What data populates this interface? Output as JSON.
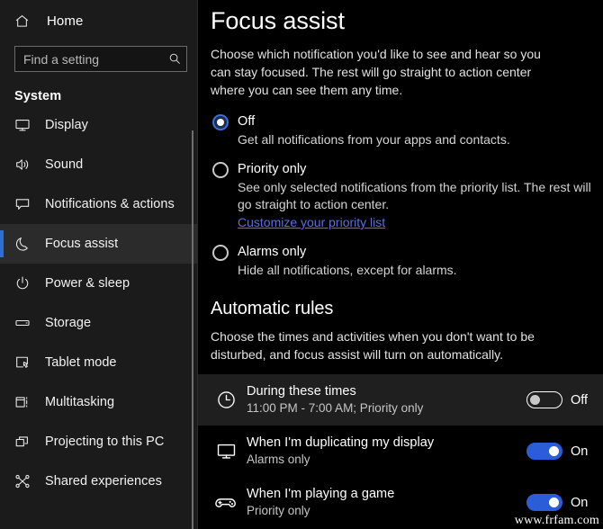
{
  "sidebar": {
    "home": {
      "label": "Home",
      "icon": "home-icon"
    },
    "search": {
      "placeholder": "Find a setting",
      "icon": "search-icon",
      "value": ""
    },
    "group_title": "System",
    "selected_index": 3,
    "accent_color": "#2f6fd0",
    "items": [
      {
        "label": "Display",
        "icon": "monitor-icon"
      },
      {
        "label": "Sound",
        "icon": "speaker-icon"
      },
      {
        "label": "Notifications & actions",
        "icon": "chat-bubble-icon"
      },
      {
        "label": "Focus assist",
        "icon": "moon-icon"
      },
      {
        "label": "Power & sleep",
        "icon": "power-icon"
      },
      {
        "label": "Storage",
        "icon": "drive-icon"
      },
      {
        "label": "Tablet mode",
        "icon": "tablet-icon"
      },
      {
        "label": "Multitasking",
        "icon": "multitask-icon"
      },
      {
        "label": "Projecting to this PC",
        "icon": "project-icon"
      },
      {
        "label": "Shared experiences",
        "icon": "share-icon"
      }
    ]
  },
  "main": {
    "title": "Focus assist",
    "description": "Choose which notification you'd like to see and hear so you can stay focused. The rest will go straight to action center where you can see them any time.",
    "modes": [
      {
        "label": "Off",
        "description": "Get all notifications from your apps and contacts.",
        "selected": true,
        "link": ""
      },
      {
        "label": "Priority only",
        "description": "See only selected notifications from the priority list. The rest will go straight to action center.",
        "selected": false,
        "link": "Customize your priority list"
      },
      {
        "label": "Alarms only",
        "description": "Hide all notifications, except for alarms.",
        "selected": false,
        "link": ""
      }
    ],
    "rules": {
      "title": "Automatic rules",
      "description": "Choose the times and activities when you don't want to be disturbed, and focus assist will turn on automatically.",
      "items": [
        {
          "name": "During these times",
          "sub": "11:00 PM - 7:00 AM; Priority only",
          "icon": "clock-icon",
          "state": "Off",
          "on": false,
          "hover": true
        },
        {
          "name": "When I'm duplicating my display",
          "sub": "Alarms only",
          "icon": "monitor-icon",
          "state": "On",
          "on": true,
          "hover": false
        },
        {
          "name": "When I'm playing a game",
          "sub": "Priority only",
          "icon": "gamepad-icon",
          "state": "On",
          "on": true,
          "hover": false
        }
      ]
    }
  },
  "watermark": "www.frfam.com"
}
